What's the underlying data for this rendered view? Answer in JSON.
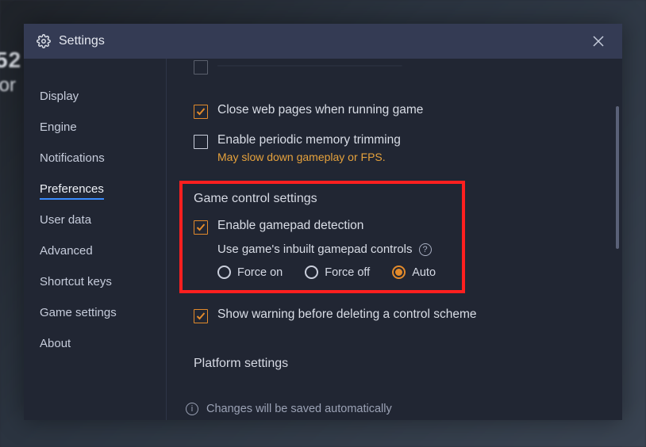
{
  "title": "Settings",
  "sidebar": {
    "items": [
      {
        "label": "Display"
      },
      {
        "label": "Engine"
      },
      {
        "label": "Notifications"
      },
      {
        "label": "Preferences",
        "active": true
      },
      {
        "label": "User data"
      },
      {
        "label": "Advanced"
      },
      {
        "label": "Shortcut keys"
      },
      {
        "label": "Game settings"
      },
      {
        "label": "About"
      }
    ]
  },
  "content": {
    "close_web_pages": {
      "label": "Close web pages when running game",
      "checked": true
    },
    "memory_trimming": {
      "label": "Enable periodic memory trimming",
      "warning": "May slow down gameplay or FPS.",
      "checked": false
    },
    "game_control_heading": "Game control settings",
    "gamepad_detection": {
      "label": "Enable gamepad detection",
      "checked": true
    },
    "inbuilt_gamepad": {
      "label": "Use game's inbuilt gamepad controls",
      "options": [
        {
          "label": "Force on",
          "selected": false
        },
        {
          "label": "Force off",
          "selected": false
        },
        {
          "label": "Auto",
          "selected": true
        }
      ]
    },
    "delete_warning": {
      "label": "Show warning before deleting a control scheme",
      "checked": true
    },
    "platform_heading": "Platform settings",
    "footer": "Changes will be saved automatically"
  },
  "colors": {
    "accent_orange": "#e28a2b",
    "accent_blue": "#3a8cff",
    "highlight_red": "#ff1f1f"
  }
}
